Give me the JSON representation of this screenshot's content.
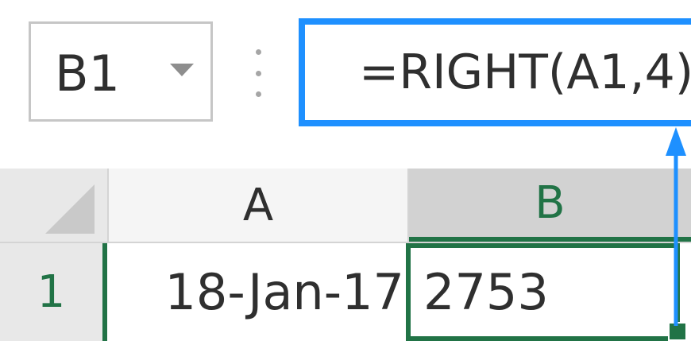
{
  "formula_bar": {
    "name_box": "B1",
    "formula": "=RIGHT(A1,4)"
  },
  "columns": [
    {
      "label": "A"
    },
    {
      "label": "B"
    }
  ],
  "rows": [
    {
      "header": "1",
      "cells": [
        "18-Jan-17",
        "2753"
      ]
    }
  ],
  "active_cell": "B1",
  "colors": {
    "accent": "#1e90ff",
    "selection": "#217346"
  },
  "icons": [
    "name-box-dropdown-icon",
    "formula-arrow-icon"
  ]
}
